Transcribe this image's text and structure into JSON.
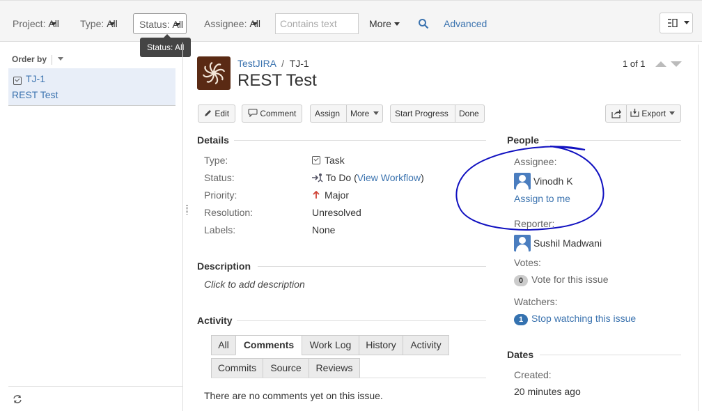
{
  "filters": {
    "project": {
      "label": "Project:",
      "value": "All"
    },
    "type": {
      "label": "Type:",
      "value": "All"
    },
    "status": {
      "label": "Status:",
      "value": "All"
    },
    "assignee": {
      "label": "Assignee:",
      "value": "All"
    },
    "text_placeholder": "Contains text",
    "more_label": "More",
    "advanced_label": "Advanced",
    "tooltip": "Status: All"
  },
  "left": {
    "order_by": "Order by",
    "item": {
      "key": "TJ-1",
      "summary": "REST Test"
    }
  },
  "issue": {
    "project": "TestJIRA",
    "separator": "/",
    "key": "TJ-1",
    "title": "REST Test",
    "pager": "1 of 1"
  },
  "toolbar": {
    "edit": "Edit",
    "comment": "Comment",
    "assign": "Assign",
    "more": "More",
    "start_progress": "Start Progress",
    "done": "Done",
    "export": "Export"
  },
  "details": {
    "heading": "Details",
    "fields": [
      {
        "label": "Type:",
        "value": "Task"
      },
      {
        "label": "Status:",
        "value": "To Do (",
        "link": "View Workflow",
        "after": ")"
      },
      {
        "label": "Priority:",
        "value": "Major"
      },
      {
        "label": "Resolution:",
        "value": "Unresolved"
      },
      {
        "label": "Labels:",
        "value": "None"
      }
    ]
  },
  "description": {
    "heading": "Description",
    "placeholder": "Click to add description"
  },
  "activity": {
    "heading": "Activity",
    "tabs": [
      "All",
      "Comments",
      "Work Log",
      "History",
      "Activity",
      "Commits",
      "Source",
      "Reviews"
    ],
    "active_tab": "Comments",
    "empty": "There are no comments yet on this issue."
  },
  "people": {
    "heading": "People",
    "assignee_label": "Assignee:",
    "assignee": "Vinodh K",
    "assign_to_me": "Assign to me",
    "reporter_label": "Reporter:",
    "reporter": "Sushil Madwani",
    "votes_label": "Votes:",
    "votes_count": "0",
    "vote_link": "Vote for this issue",
    "watchers_label": "Watchers:",
    "watchers_count": "1",
    "watch_link": "Stop watching this issue"
  },
  "dates": {
    "heading": "Dates",
    "created_label": "Created:",
    "created": "20 minutes ago"
  },
  "colors": {
    "link": "#3b73af",
    "annotation": "#1010c0",
    "priority": "#d04437"
  }
}
